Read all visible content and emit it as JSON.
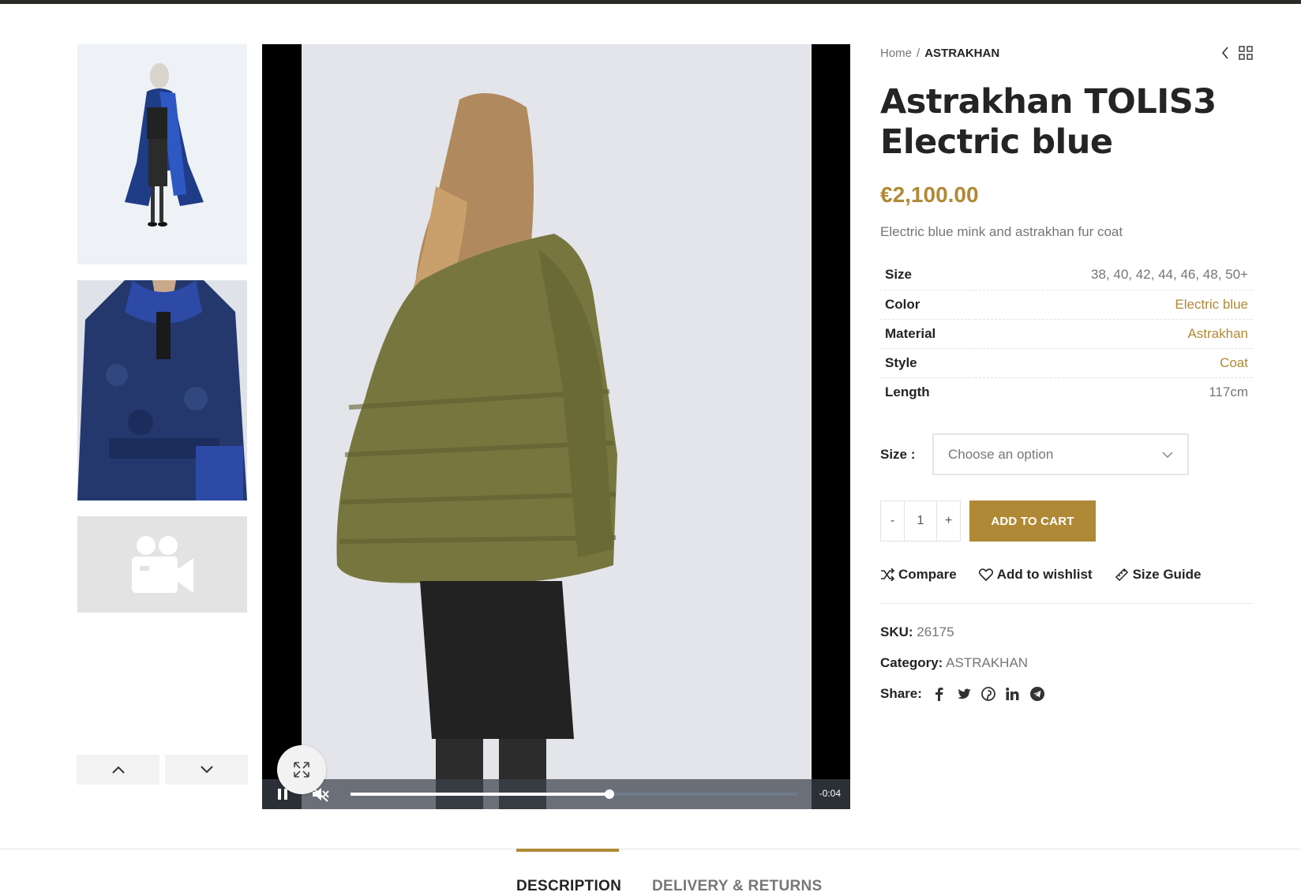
{
  "thumbnails": {
    "prev_label": "previous-thumbnail",
    "next_label": "next-thumbnail",
    "video_icon": "video-camera-icon"
  },
  "video": {
    "time_remaining": "-0:04",
    "progress_fraction": 0.58,
    "muted": true,
    "playing": true
  },
  "breadcrumb": {
    "home": "Home",
    "separator": "/",
    "current": "ASTRAKHAN"
  },
  "product": {
    "title": "Astrakhan TOLIS3 Electric blue",
    "price": "€2,100.00",
    "short_description": "Electric blue mink and astrakhan fur coat"
  },
  "attributes": [
    {
      "label": "Size",
      "value": "38, 40, 42, 44, 46, 48, 50+",
      "link": false
    },
    {
      "label": "Color",
      "value": "Electric blue",
      "link": true
    },
    {
      "label": "Material",
      "value": "Astrakhan",
      "link": true
    },
    {
      "label": "Style",
      "value": "Coat",
      "link": true
    },
    {
      "label": "Length",
      "value": "117cm",
      "link": false
    }
  ],
  "variation": {
    "label": "Size :",
    "placeholder": "Choose an option"
  },
  "cart": {
    "minus": "-",
    "quantity": "1",
    "plus": "+",
    "add_label": "ADD TO CART"
  },
  "actions": {
    "compare": "Compare",
    "wishlist": "Add to wishlist",
    "size_guide": "Size Guide"
  },
  "meta": {
    "sku_label": "SKU:",
    "sku": "26175",
    "category_label": "Category:",
    "category": "ASTRAKHAN",
    "share_label": "Share:"
  },
  "tabs": {
    "description": "DESCRIPTION",
    "delivery": "DELIVERY & RETURNS"
  },
  "colors": {
    "accent": "#b08936",
    "text": "#242424",
    "muted": "#767676"
  }
}
